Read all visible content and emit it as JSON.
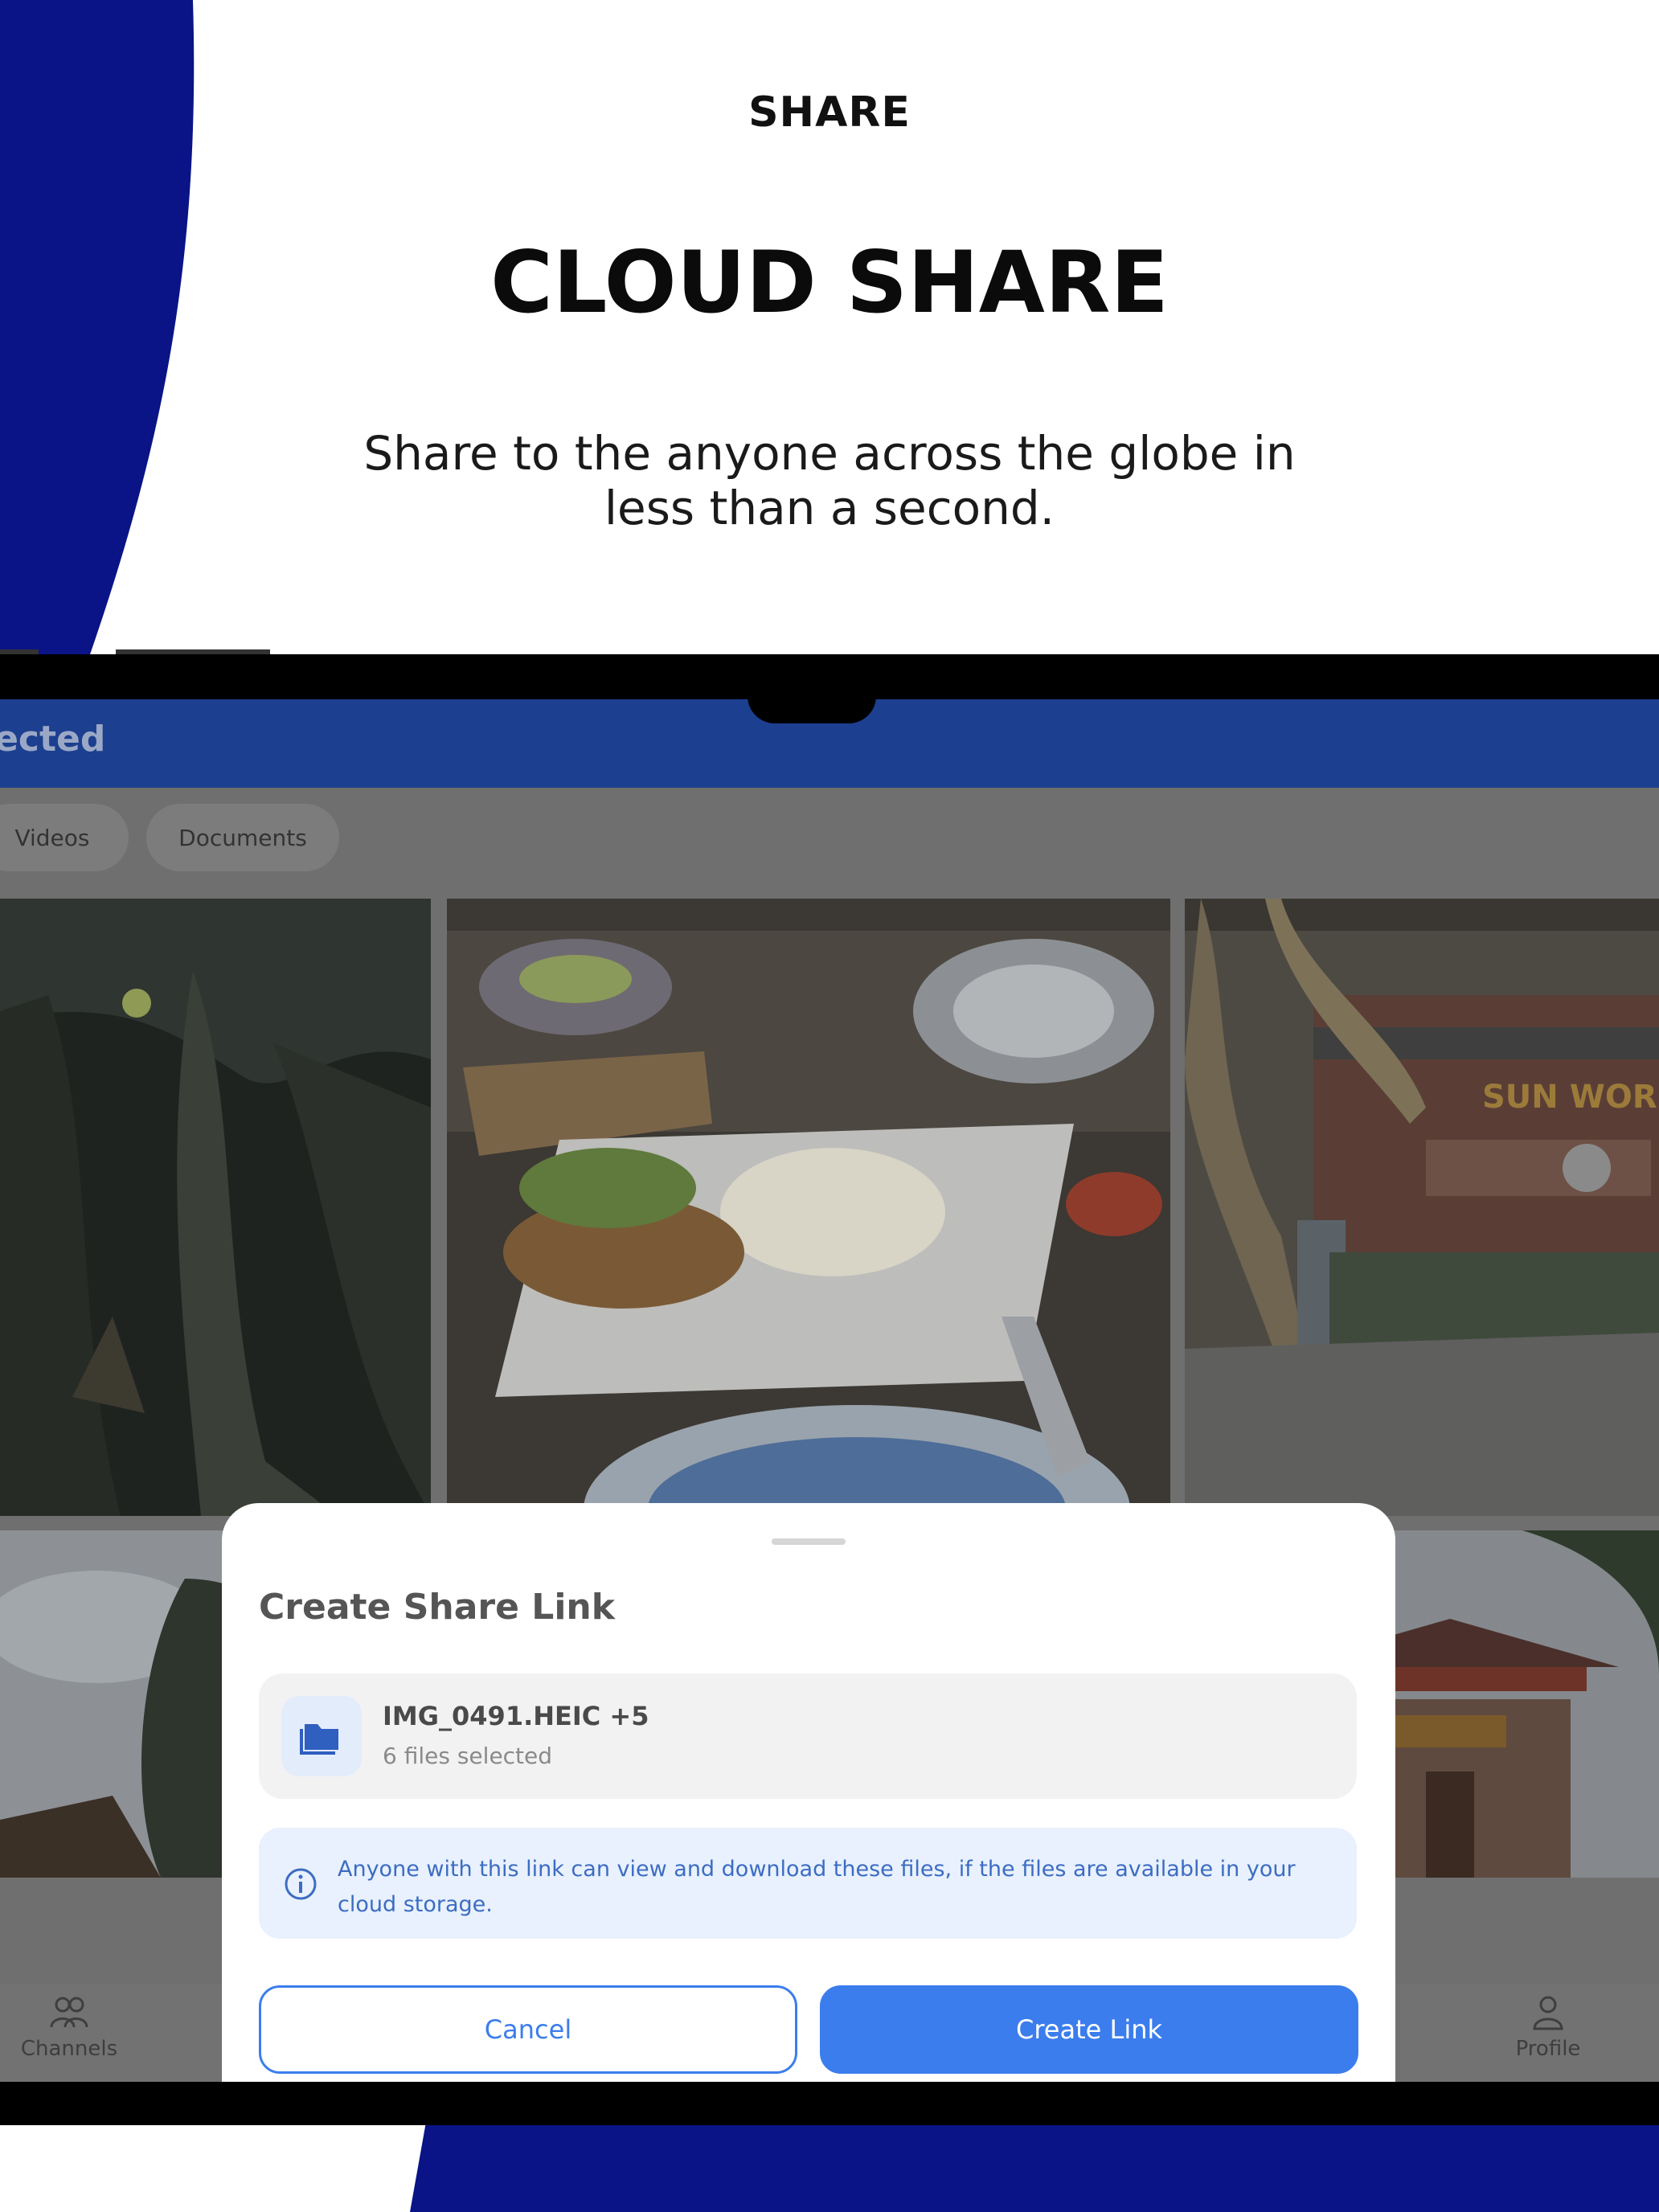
{
  "promo": {
    "eyebrow": "SHARE",
    "headline": "CLOUD SHARE",
    "subline": "Share to the anyone across the globe in less than a second."
  },
  "app_bar": {
    "title": "lected"
  },
  "filter_chips": [
    {
      "label": "Videos"
    },
    {
      "label": "Documents"
    }
  ],
  "bottom_nav": {
    "channels_label": "Channels",
    "profile_label": "Profile"
  },
  "share_sheet": {
    "title": "Create Share Link",
    "file_name": "IMG_0491.HEIC +5",
    "file_count": "6 files selected",
    "info_text": "Anyone with this link can view and download these files, if the files are available in your cloud storage.",
    "cancel_label": "Cancel",
    "create_label": "Create Link"
  },
  "photos": {
    "sign_text": "SUN WORLD"
  },
  "colors": {
    "brand_navy": "#0a1486",
    "app_bar_blue": "#1c3f8f",
    "primary_blue": "#3b7ded",
    "info_bg": "#e8f1fd"
  },
  "icons": {
    "channels": "people-icon",
    "profile": "person-icon",
    "file": "folder-icon",
    "info": "info-icon"
  }
}
